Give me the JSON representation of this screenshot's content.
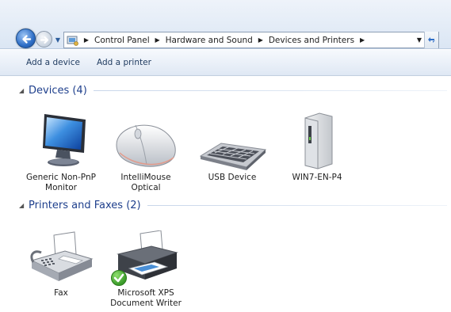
{
  "address_bar": {
    "breadcrumbs": [
      "Control Panel",
      "Hardware and Sound",
      "Devices and Printers"
    ]
  },
  "command_bar": {
    "add_device": "Add a device",
    "add_printer": "Add a printer"
  },
  "groups": {
    "devices": {
      "title": "Devices (4)",
      "items": [
        {
          "label": "Generic Non-PnP Monitor",
          "icon": "monitor-icon"
        },
        {
          "label": "IntelliMouse Optical",
          "icon": "mouse-icon"
        },
        {
          "label": "USB Device",
          "icon": "keyboard-icon"
        },
        {
          "label": "WIN7-EN-P4",
          "icon": "computer-tower-icon"
        }
      ]
    },
    "printers": {
      "title": "Printers and Faxes (2)",
      "items": [
        {
          "label": "Fax",
          "icon": "fax-icon"
        },
        {
          "label": "Microsoft XPS Document Writer",
          "icon": "printer-icon",
          "default": true
        }
      ]
    }
  },
  "colors": {
    "group_title": "#1e3f8c",
    "command_text": "#1e3a5f",
    "default_check": "#3a9b2a"
  }
}
